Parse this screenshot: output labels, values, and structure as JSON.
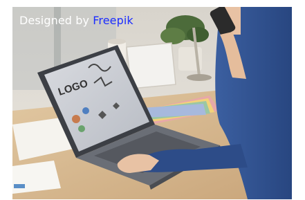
{
  "credit": {
    "text": "Designed by ",
    "link_label": "Freepik"
  },
  "laptop_screen": {
    "logo_text": "LOGO"
  },
  "colors": {
    "credit_text": "#ffffff",
    "credit_link": "#1a2cff",
    "shirt": "#2f4f8f",
    "laptop": "#6a6e76",
    "desk": "#d2b48c",
    "wall": "#e9e5df"
  }
}
